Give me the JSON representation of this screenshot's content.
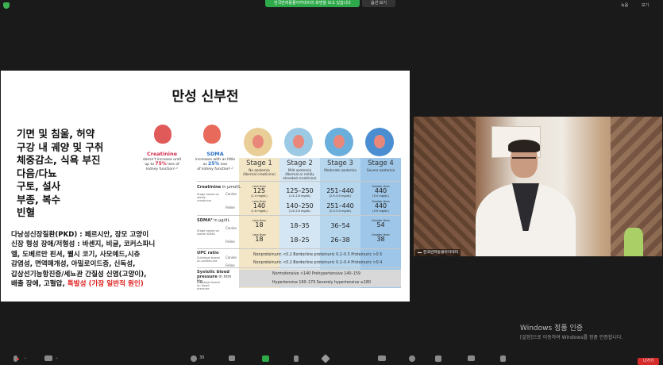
{
  "top_bar": {
    "share_notice": "한국반려동물아카데미의 화면을 보고 있습니다",
    "view_options": "옵션 보기",
    "record_label": "녹음",
    "view_label": "보기"
  },
  "slide": {
    "title": "만성 신부전",
    "symptoms": [
      "기면 및 침울, 허약",
      "구강 내 궤양 및 구취",
      "체중감소, 식욕 부진",
      "다음/다뇨",
      "구토, 설사",
      "부종, 복수",
      "빈혈"
    ],
    "causes": [
      "다낭성신장질환(PKD) : 페르시안, 장모 고양이",
      "신장 형성 장애/저형성 : 바센지, 비글, 코커스파니",
      "엘, 도베르만 핀셔, 웰시 코기, 사모예드,시츄",
      "감염성, 면역매개성, 아밀로이드증, 신독성,",
      "갑상선기능항진증/세뇨관 간질성 신염(고양이),",
      "배출 장애, 고혈압, "
    ],
    "causes_highlight": "특발성 (가장 일반적 원인)",
    "creatinine_box": {
      "title": "Creatinine",
      "line1": "doesn't increase until",
      "line2a": "up to ",
      "pct": "75%",
      "line2b": " loss of",
      "line3": "kidney function¹·²"
    },
    "sdma_box": {
      "title": "SDMA",
      "line1": "increases with as little",
      "line2a": "as ",
      "pct": "25%",
      "line2b": " loss",
      "line3": "of kidney function¹·²"
    },
    "stages": [
      {
        "name": "Stage 1",
        "sub1": "No azotemia",
        "sub2": "(Normal creatinine)"
      },
      {
        "name": "Stage 2",
        "sub1": "Mild azotemia",
        "sub2": "(Normal or mildly elevated creatinine)"
      },
      {
        "name": "Stage 3",
        "sub1": "Moderate azotemia",
        "sub2": ""
      },
      {
        "name": "Stage 4",
        "sub1": "Severe azotemia",
        "sub2": ""
      }
    ],
    "rows": {
      "creatinine_label": "Creatinine",
      "creatinine_unit": "in μmol/L",
      "stage_note": "Stage based on stable creatinine",
      "canine": "Canine",
      "feline": "Feline",
      "creat_canine": [
        {
          "pre": "Less than",
          "val": "125",
          "sub": "(1.4 mg/dL)"
        },
        {
          "pre": "",
          "val": "125–250",
          "sub": "(1.4–2.8 mg/dL)"
        },
        {
          "pre": "",
          "val": "251–440",
          "sub": "(2.9–5.0 mg/dL)"
        },
        {
          "pre": "Greater than",
          "val": "440",
          "sub": "(5.0 mg/dL)"
        }
      ],
      "creat_feline": [
        {
          "pre": "Less than",
          "val": "140",
          "sub": "(1.6 mg/dL)"
        },
        {
          "pre": "",
          "val": "140–250",
          "sub": "(1.6–2.8 mg/dL)"
        },
        {
          "pre": "",
          "val": "251–440",
          "sub": "(2.9–5.0 mg/dL)"
        },
        {
          "pre": "Greater than",
          "val": "440",
          "sub": "(5.0 mg/dL)"
        }
      ],
      "sdma_label": "SDMA³",
      "sdma_unit": "in μg/dL",
      "sdma_note": "Stage based on stable SDMA",
      "sdma_canine": [
        {
          "pre": "Less than",
          "val": "18"
        },
        {
          "pre": "",
          "val": "18–35"
        },
        {
          "pre": "",
          "val": "36–54"
        },
        {
          "pre": "Greater than",
          "val": "54"
        }
      ],
      "sdma_feline": [
        {
          "pre": "Less than",
          "val": "18"
        },
        {
          "pre": "",
          "val": "18–25"
        },
        {
          "pre": "",
          "val": "26–38"
        },
        {
          "pre": "Greater than",
          "val": "38"
        }
      ],
      "upc_label": "UPC ratio",
      "upc_note": "Substage based on proteinuria",
      "upc_canine": "Nonproteinuric <0.2   Borderline proteinuric 0.2–0.5   Proteinuric >0.5",
      "upc_feline": "Nonproteinuric <0.2   Borderline proteinuric 0.2–0.4   Proteinuric >0.4",
      "bp_label": "Systolic blood pressure",
      "bp_unit": "in mm Hg",
      "bp_note": "Substage based on blood pressure",
      "bp_line1": "Normotensive <140   Prehypertensive 140–159",
      "bp_line2": "Hypertensive 160–179   Severely hypertensive ≥180"
    }
  },
  "camera": {
    "name": "한국반려동물아카데미"
  },
  "windows_activation": {
    "title": "Windows 정품 인증",
    "subtitle": "[설정]으로 이동하여 Windows를 정품 인증합니다."
  },
  "toolbar": {
    "participants_count": "30",
    "leave_label": "나가기"
  }
}
